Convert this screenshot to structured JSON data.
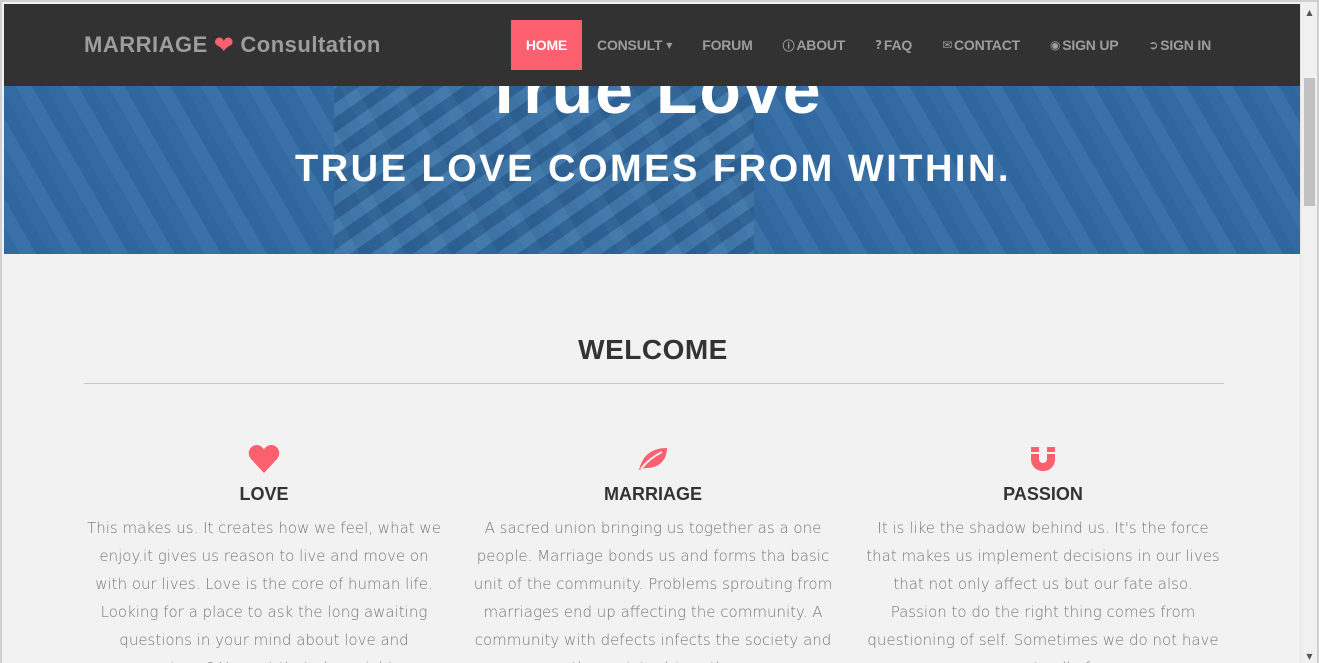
{
  "hero": {
    "title": "True Love",
    "subtitle": "TRUE LOVE COMES FROM WITHIN."
  },
  "navbar": {
    "brand_left": "MARRIAGE",
    "brand_right": "Consultation",
    "items": [
      {
        "label": "HOME",
        "icon": ""
      },
      {
        "label": "CONSULT",
        "icon": ""
      },
      {
        "label": "FORUM",
        "icon": ""
      },
      {
        "label": "ABOUT",
        "icon": "info-icon"
      },
      {
        "label": "FAQ",
        "icon": "question-icon"
      },
      {
        "label": "CONTACT",
        "icon": "envelope-icon"
      },
      {
        "label": "SIGN UP",
        "icon": "eye-icon"
      },
      {
        "label": "SIGN IN",
        "icon": "sign-in-icon"
      }
    ],
    "active_color": "#fc5f6e"
  },
  "welcome": {
    "title": "WELCOME"
  },
  "features": [
    {
      "title": "LOVE",
      "icon": "heart-icon",
      "text": "This makes us. It creates how we feel, what we enjoy.it gives us reason to live and move on with our lives. Love is the core of human life. Looking for a place to ask the long awaiting questions in your mind about love and marriage ? You got that place right"
    },
    {
      "title": "MARRIAGE",
      "icon": "leaf-icon",
      "text": "A sacred union bringing us together as a one people. Marriage bonds us and forms tha basic unit of the community. Problems sprouting from marriages end up affecting the community. A community with defects infects the society and the society drives the"
    },
    {
      "title": "PASSION",
      "icon": "magnet-icon",
      "text": "It is like the shadow behind us. It's the force that makes us implement decisions in our lives that not only affect us but our fate also. Passion to do the right thing comes from questioning of self. Sometimes we do not have answers to all of our"
    }
  ]
}
